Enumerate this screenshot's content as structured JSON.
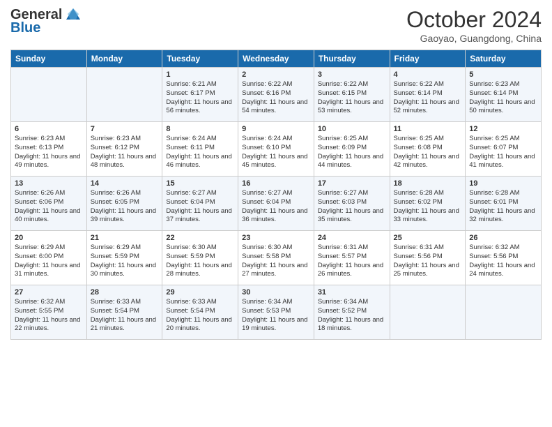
{
  "header": {
    "logo_line1": "General",
    "logo_line2": "Blue",
    "month": "October 2024",
    "location": "Gaoyao, Guangdong, China"
  },
  "days_of_week": [
    "Sunday",
    "Monday",
    "Tuesday",
    "Wednesday",
    "Thursday",
    "Friday",
    "Saturday"
  ],
  "weeks": [
    [
      {
        "day": "",
        "sunrise": "",
        "sunset": "",
        "daylight": ""
      },
      {
        "day": "",
        "sunrise": "",
        "sunset": "",
        "daylight": ""
      },
      {
        "day": "1",
        "sunrise": "Sunrise: 6:21 AM",
        "sunset": "Sunset: 6:17 PM",
        "daylight": "Daylight: 11 hours and 56 minutes."
      },
      {
        "day": "2",
        "sunrise": "Sunrise: 6:22 AM",
        "sunset": "Sunset: 6:16 PM",
        "daylight": "Daylight: 11 hours and 54 minutes."
      },
      {
        "day": "3",
        "sunrise": "Sunrise: 6:22 AM",
        "sunset": "Sunset: 6:15 PM",
        "daylight": "Daylight: 11 hours and 53 minutes."
      },
      {
        "day": "4",
        "sunrise": "Sunrise: 6:22 AM",
        "sunset": "Sunset: 6:14 PM",
        "daylight": "Daylight: 11 hours and 52 minutes."
      },
      {
        "day": "5",
        "sunrise": "Sunrise: 6:23 AM",
        "sunset": "Sunset: 6:14 PM",
        "daylight": "Daylight: 11 hours and 50 minutes."
      }
    ],
    [
      {
        "day": "6",
        "sunrise": "Sunrise: 6:23 AM",
        "sunset": "Sunset: 6:13 PM",
        "daylight": "Daylight: 11 hours and 49 minutes."
      },
      {
        "day": "7",
        "sunrise": "Sunrise: 6:23 AM",
        "sunset": "Sunset: 6:12 PM",
        "daylight": "Daylight: 11 hours and 48 minutes."
      },
      {
        "day": "8",
        "sunrise": "Sunrise: 6:24 AM",
        "sunset": "Sunset: 6:11 PM",
        "daylight": "Daylight: 11 hours and 46 minutes."
      },
      {
        "day": "9",
        "sunrise": "Sunrise: 6:24 AM",
        "sunset": "Sunset: 6:10 PM",
        "daylight": "Daylight: 11 hours and 45 minutes."
      },
      {
        "day": "10",
        "sunrise": "Sunrise: 6:25 AM",
        "sunset": "Sunset: 6:09 PM",
        "daylight": "Daylight: 11 hours and 44 minutes."
      },
      {
        "day": "11",
        "sunrise": "Sunrise: 6:25 AM",
        "sunset": "Sunset: 6:08 PM",
        "daylight": "Daylight: 11 hours and 42 minutes."
      },
      {
        "day": "12",
        "sunrise": "Sunrise: 6:25 AM",
        "sunset": "Sunset: 6:07 PM",
        "daylight": "Daylight: 11 hours and 41 minutes."
      }
    ],
    [
      {
        "day": "13",
        "sunrise": "Sunrise: 6:26 AM",
        "sunset": "Sunset: 6:06 PM",
        "daylight": "Daylight: 11 hours and 40 minutes."
      },
      {
        "day": "14",
        "sunrise": "Sunrise: 6:26 AM",
        "sunset": "Sunset: 6:05 PM",
        "daylight": "Daylight: 11 hours and 39 minutes."
      },
      {
        "day": "15",
        "sunrise": "Sunrise: 6:27 AM",
        "sunset": "Sunset: 6:04 PM",
        "daylight": "Daylight: 11 hours and 37 minutes."
      },
      {
        "day": "16",
        "sunrise": "Sunrise: 6:27 AM",
        "sunset": "Sunset: 6:04 PM",
        "daylight": "Daylight: 11 hours and 36 minutes."
      },
      {
        "day": "17",
        "sunrise": "Sunrise: 6:27 AM",
        "sunset": "Sunset: 6:03 PM",
        "daylight": "Daylight: 11 hours and 35 minutes."
      },
      {
        "day": "18",
        "sunrise": "Sunrise: 6:28 AM",
        "sunset": "Sunset: 6:02 PM",
        "daylight": "Daylight: 11 hours and 33 minutes."
      },
      {
        "day": "19",
        "sunrise": "Sunrise: 6:28 AM",
        "sunset": "Sunset: 6:01 PM",
        "daylight": "Daylight: 11 hours and 32 minutes."
      }
    ],
    [
      {
        "day": "20",
        "sunrise": "Sunrise: 6:29 AM",
        "sunset": "Sunset: 6:00 PM",
        "daylight": "Daylight: 11 hours and 31 minutes."
      },
      {
        "day": "21",
        "sunrise": "Sunrise: 6:29 AM",
        "sunset": "Sunset: 5:59 PM",
        "daylight": "Daylight: 11 hours and 30 minutes."
      },
      {
        "day": "22",
        "sunrise": "Sunrise: 6:30 AM",
        "sunset": "Sunset: 5:59 PM",
        "daylight": "Daylight: 11 hours and 28 minutes."
      },
      {
        "day": "23",
        "sunrise": "Sunrise: 6:30 AM",
        "sunset": "Sunset: 5:58 PM",
        "daylight": "Daylight: 11 hours and 27 minutes."
      },
      {
        "day": "24",
        "sunrise": "Sunrise: 6:31 AM",
        "sunset": "Sunset: 5:57 PM",
        "daylight": "Daylight: 11 hours and 26 minutes."
      },
      {
        "day": "25",
        "sunrise": "Sunrise: 6:31 AM",
        "sunset": "Sunset: 5:56 PM",
        "daylight": "Daylight: 11 hours and 25 minutes."
      },
      {
        "day": "26",
        "sunrise": "Sunrise: 6:32 AM",
        "sunset": "Sunset: 5:56 PM",
        "daylight": "Daylight: 11 hours and 24 minutes."
      }
    ],
    [
      {
        "day": "27",
        "sunrise": "Sunrise: 6:32 AM",
        "sunset": "Sunset: 5:55 PM",
        "daylight": "Daylight: 11 hours and 22 minutes."
      },
      {
        "day": "28",
        "sunrise": "Sunrise: 6:33 AM",
        "sunset": "Sunset: 5:54 PM",
        "daylight": "Daylight: 11 hours and 21 minutes."
      },
      {
        "day": "29",
        "sunrise": "Sunrise: 6:33 AM",
        "sunset": "Sunset: 5:54 PM",
        "daylight": "Daylight: 11 hours and 20 minutes."
      },
      {
        "day": "30",
        "sunrise": "Sunrise: 6:34 AM",
        "sunset": "Sunset: 5:53 PM",
        "daylight": "Daylight: 11 hours and 19 minutes."
      },
      {
        "day": "31",
        "sunrise": "Sunrise: 6:34 AM",
        "sunset": "Sunset: 5:52 PM",
        "daylight": "Daylight: 11 hours and 18 minutes."
      },
      {
        "day": "",
        "sunrise": "",
        "sunset": "",
        "daylight": ""
      },
      {
        "day": "",
        "sunrise": "",
        "sunset": "",
        "daylight": ""
      }
    ]
  ]
}
